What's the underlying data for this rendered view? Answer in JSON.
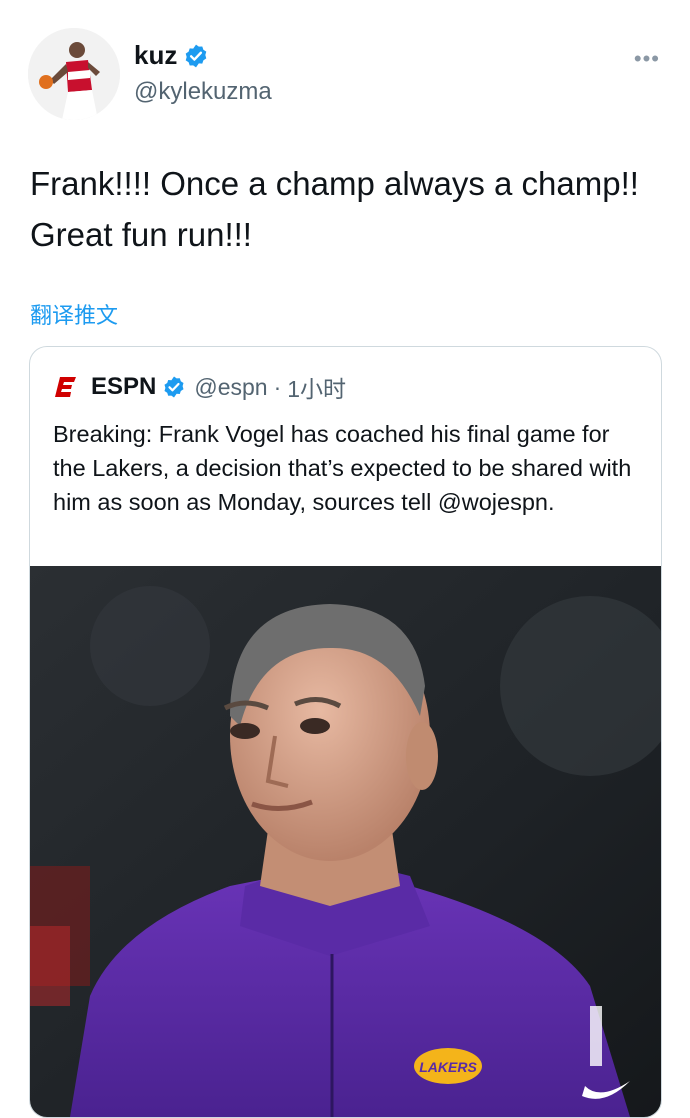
{
  "tweet": {
    "display_name": "kuz",
    "handle": "@kylekuzma",
    "more_label": "•••",
    "text": "Frank!!!! Once a champ always a champ!! Great fun run!!!",
    "translate_label": "翻译推文"
  },
  "quoted": {
    "name": "ESPN",
    "handle": "@espn",
    "separator": "·",
    "time": "1小时",
    "text": "Breaking: Frank Vogel has coached his final game for the Lakers, a decision that’s expected to be shared with him as soon as Monday, sources tell @wojespn.",
    "image_logo_text": "LAKERS"
  },
  "colors": {
    "link": "#1d9bf0",
    "verified": "#1d9bf0",
    "espn_red": "#d00000",
    "lakers_purple": "#5b2d9e"
  },
  "icons": [
    "verified-badge-icon",
    "more-options-icon",
    "espn-logo-icon"
  ]
}
